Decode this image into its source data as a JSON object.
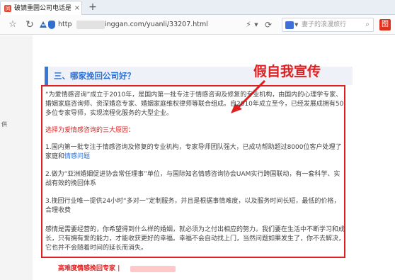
{
  "tab": {
    "title": "破镜重圆公司电话是多少...",
    "favicon": "ifeng-icon",
    "close_label": "×",
    "new_tab_label": "+"
  },
  "toolbar": {
    "url_prefix": "http",
    "url_rest": "inggan.com/yuanli/33207.html",
    "search_placeholder": "妻子的浪漫旅行",
    "ext_label": "图"
  },
  "page": {
    "side_label": "供",
    "section_title": "三、哪家挽回公司好？",
    "annotation": "假自我宣传",
    "p1": "“为爱情感咨询”成立于2010年，是国内第一批专注于情感咨询及修复的专业机构，由国内的心理学专家、婚姻家庭咨询师、资深婚恋专家、婚姻家庭维权律师等联合组成。自2010年成立至今，已经发展成拥有50多位专家导师，实现流程化服务的大型企业。",
    "p2": "选择为爱情感咨询的三大原因：",
    "p3_text": "1.国内第一批专注于情感咨询及修复的专业机构，专家导师团队强大，已成功帮助超过8000位客户处理了家庭和",
    "p3_link": "情感问题",
    "p4": "2.做为“亚洲婚姻促进协会常任理事”单位，与国际知名情感咨询协会UAM实行跨国联动，有一套科学、实战有效的挽回体系",
    "p5": "3.挽回行业唯一提供24小时“多对一”定制服务，并且是根据事情难度，以及服务时间长短，最低的价格，合理收费",
    "p6": "感情是需要经营的，你希望得到什么样的婚姻，就必须为之付出相应的努力。我们要在生活中不断学习和成长，只有拥有爱的能力，才能收获更好的幸福。幸福不会自动找上门，当然问题如果发生了，你不去解决，它也并不会随着时间的延长而消失。",
    "footer_title": "高难度情感挽回专家 |"
  },
  "colors": {
    "accent_blue": "#2f6fd1",
    "annotation_red": "#e02020"
  }
}
